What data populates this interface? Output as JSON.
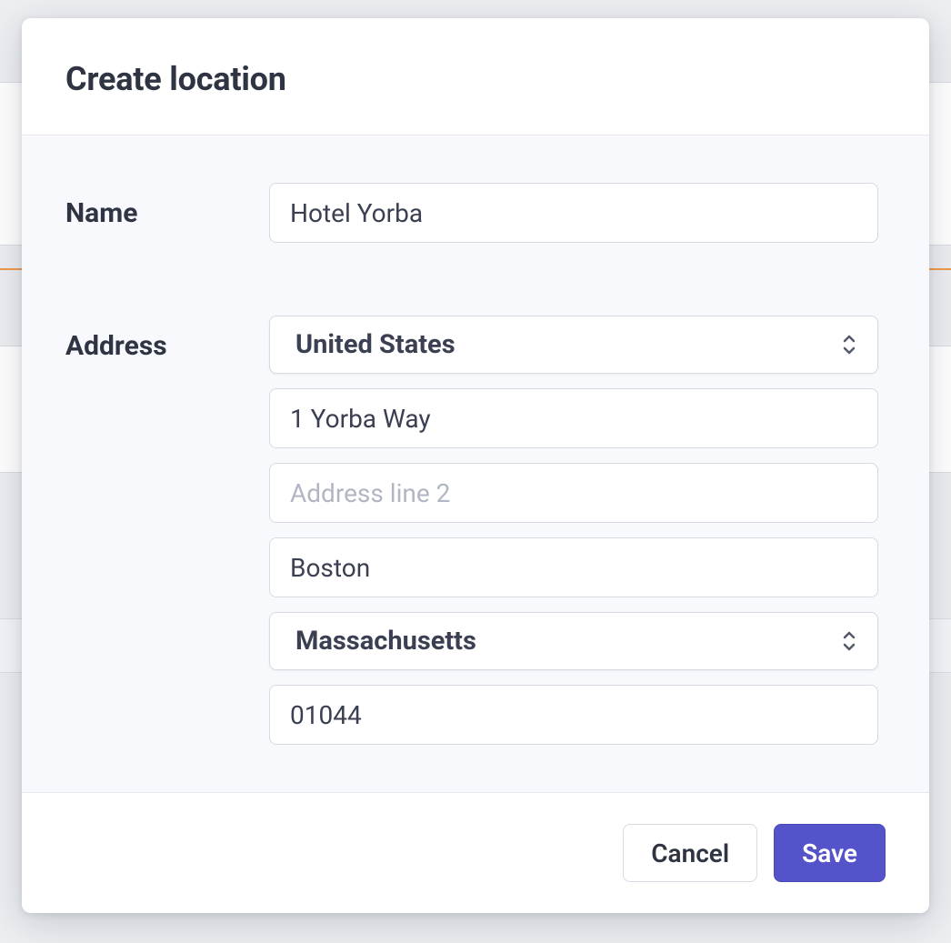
{
  "modal": {
    "title": "Create location",
    "labels": {
      "name": "Name",
      "address": "Address"
    },
    "fields": {
      "name": "Hotel Yorba",
      "country": "United States",
      "address1": "1 Yorba Way",
      "address2": "",
      "address2_placeholder": "Address line 2",
      "city": "Boston",
      "state": "Massachusetts",
      "postal": "01044"
    },
    "buttons": {
      "cancel": "Cancel",
      "save": "Save"
    }
  }
}
